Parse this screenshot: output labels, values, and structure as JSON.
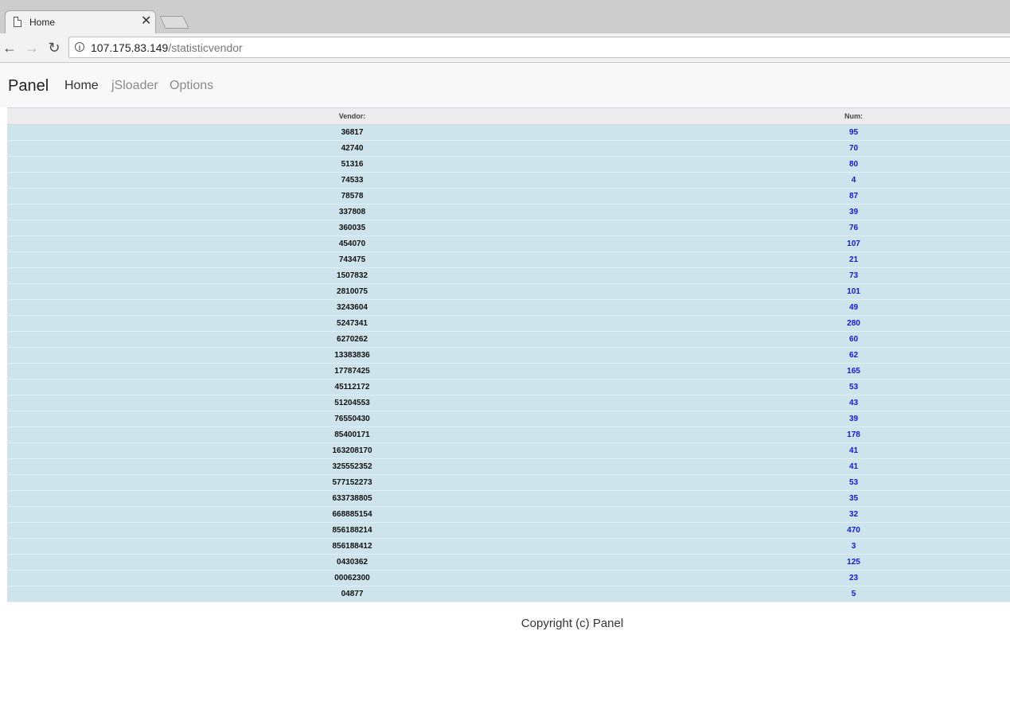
{
  "browser": {
    "tab_title": "Home",
    "tab_close": "✕",
    "url_host": "107.175.83.149",
    "url_path": "/statisticvendor",
    "back": "←",
    "forward": "→",
    "reload": "↻",
    "info": "i"
  },
  "navbar": {
    "brand": "Panel",
    "links": [
      {
        "label": "Home",
        "state": "active"
      },
      {
        "label": "jSloader",
        "state": "muted"
      },
      {
        "label": "Options",
        "state": "muted"
      }
    ]
  },
  "table": {
    "headers": {
      "vendor": "Vendor:",
      "num": "Num:"
    },
    "rows": [
      {
        "vendor": "36817",
        "num": "95"
      },
      {
        "vendor": "42740",
        "num": "70"
      },
      {
        "vendor": "51316",
        "num": "80"
      },
      {
        "vendor": "74533",
        "num": "4"
      },
      {
        "vendor": "78578",
        "num": "87"
      },
      {
        "vendor": "337808",
        "num": "39"
      },
      {
        "vendor": "360035",
        "num": "76"
      },
      {
        "vendor": "454070",
        "num": "107"
      },
      {
        "vendor": "743475",
        "num": "21"
      },
      {
        "vendor": "1507832",
        "num": "73"
      },
      {
        "vendor": "2810075",
        "num": "101"
      },
      {
        "vendor": "3243604",
        "num": "49"
      },
      {
        "vendor": "5247341",
        "num": "280"
      },
      {
        "vendor": "6270262",
        "num": "60"
      },
      {
        "vendor": "13383836",
        "num": "62"
      },
      {
        "vendor": "17787425",
        "num": "165"
      },
      {
        "vendor": "45112172",
        "num": "53"
      },
      {
        "vendor": "51204553",
        "num": "43"
      },
      {
        "vendor": "76550430",
        "num": "39"
      },
      {
        "vendor": "85400171",
        "num": "178"
      },
      {
        "vendor": "163208170",
        "num": "41"
      },
      {
        "vendor": "325552352",
        "num": "41"
      },
      {
        "vendor": "577152273",
        "num": "53"
      },
      {
        "vendor": "633738805",
        "num": "35"
      },
      {
        "vendor": "668885154",
        "num": "32"
      },
      {
        "vendor": "856188214",
        "num": "470"
      },
      {
        "vendor": "856188412",
        "num": "3"
      },
      {
        "vendor": "0430362",
        "num": "125"
      },
      {
        "vendor": "00062300",
        "num": "23"
      },
      {
        "vendor": "04877",
        "num": "5"
      }
    ]
  },
  "footer": {
    "text": "Copyright (c) Panel"
  },
  "colors": {
    "row_bg": "#cde4ec",
    "num_text": "#1515e6",
    "header_bg": "#ececef"
  }
}
